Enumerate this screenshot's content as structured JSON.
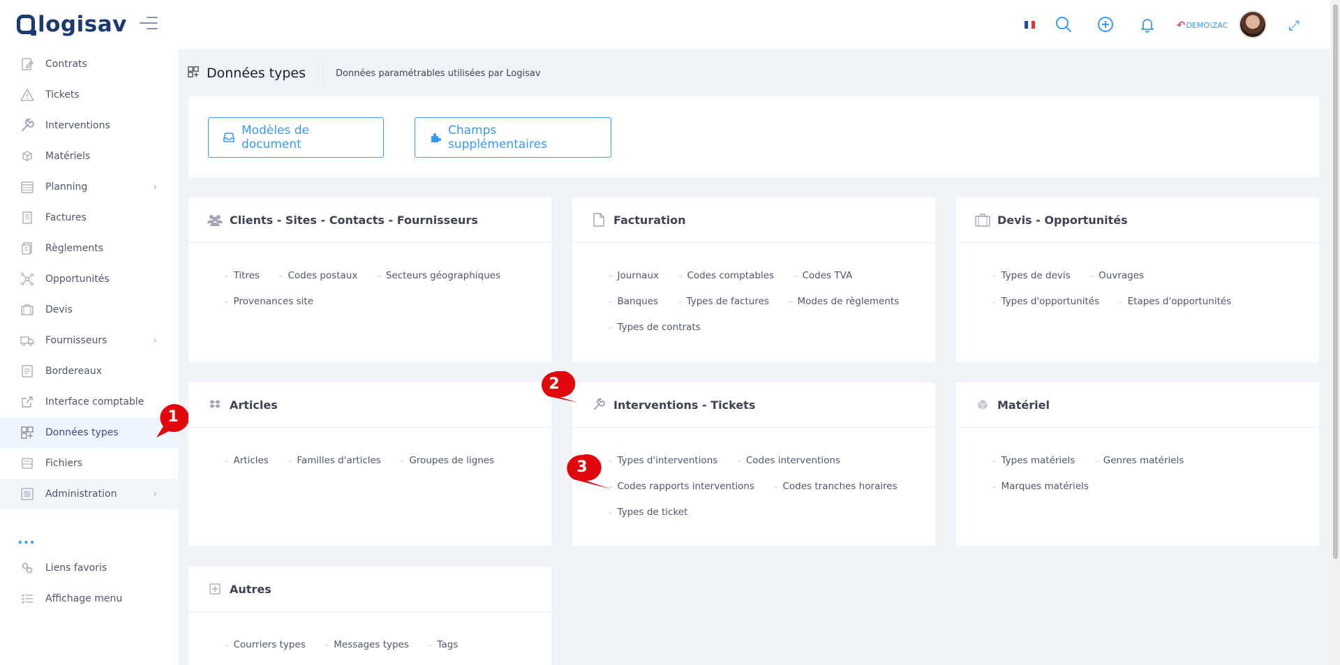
{
  "brand": {
    "name": "logisav"
  },
  "header": {
    "user": "DEMO\\ZAC",
    "icons": [
      "flag-fr-icon",
      "search-icon",
      "plus-circle-icon",
      "bell-icon",
      "undo-icon",
      "avatar",
      "expand-icon"
    ],
    "colors": {
      "accent": "#3699ff",
      "danger": "#f1416c",
      "brand": "#1c3a6e"
    }
  },
  "sidebar": {
    "items": [
      {
        "label": "Contrats",
        "icon": "contract-icon"
      },
      {
        "label": "Tickets",
        "icon": "warning-triangle-icon"
      },
      {
        "label": "Interventions",
        "icon": "wrench-icon"
      },
      {
        "label": "Matériels",
        "icon": "cube-icon"
      },
      {
        "label": "Planning",
        "icon": "calendar-icon",
        "has_children": true
      },
      {
        "label": "Factures",
        "icon": "invoice-icon"
      },
      {
        "label": "Règlements",
        "icon": "payments-icon"
      },
      {
        "label": "Opportunités",
        "icon": "network-icon"
      },
      {
        "label": "Devis",
        "icon": "briefcase-icon"
      },
      {
        "label": "Fournisseurs",
        "icon": "truck-icon",
        "has_children": true
      },
      {
        "label": "Bordereaux",
        "icon": "list-icon"
      },
      {
        "label": "Interface comptable",
        "icon": "external-link-icon"
      },
      {
        "label": "Données types",
        "icon": "grid-plus-icon",
        "active": true
      },
      {
        "label": "Fichiers",
        "icon": "folder-icon"
      },
      {
        "label": "Administration",
        "icon": "sliders-icon",
        "has_children": true
      }
    ],
    "more": "...",
    "bottom_items": [
      {
        "label": "Liens favoris",
        "icon": "link-icon"
      },
      {
        "label": "Affichage menu",
        "icon": "checklist-icon"
      }
    ]
  },
  "subheader": {
    "title": "Données types",
    "description": "Données paramétrables utilisées par Logisav"
  },
  "top_buttons": {
    "document_models": "Modèles de document",
    "extra_fields": "Champs supplémentaires"
  },
  "cards": {
    "clients": {
      "title": "Clients - Sites - Contacts - Fournisseurs",
      "rows": [
        [
          "Titres",
          "Codes postaux",
          "Secteurs géographiques"
        ],
        [
          "Provenances site"
        ]
      ]
    },
    "facturation": {
      "title": "Facturation",
      "rows": [
        [
          "Journaux",
          "Codes comptables",
          "Codes TVA"
        ],
        [
          "Banques",
          "Types de factures",
          "Modes de règlements"
        ],
        [
          "Types de contrats"
        ]
      ]
    },
    "devis": {
      "title": "Devis - Opportunités",
      "rows": [
        [
          "Types de devis",
          "Ouvrages"
        ],
        [
          "Types d'opportunités",
          "Etapes d'opportunités"
        ]
      ]
    },
    "articles": {
      "title": "Articles",
      "rows": [
        [
          "Articles",
          "Familles d'articles",
          "Groupes de lignes"
        ]
      ]
    },
    "interventions": {
      "title": "Interventions - Tickets",
      "rows": [
        [
          "Types d'interventions",
          "Codes interventions"
        ],
        [
          "Codes rapports interventions",
          "Codes tranches horaires"
        ],
        [
          "Types de ticket"
        ]
      ]
    },
    "materiel": {
      "title": "Matériel",
      "rows": [
        [
          "Types matériels",
          "Genres matériels"
        ],
        [
          "Marques matériels"
        ]
      ]
    },
    "autres": {
      "title": "Autres",
      "rows": [
        [
          "Courriers types",
          "Messages types",
          "Tags"
        ]
      ]
    }
  },
  "callouts": [
    "1",
    "2",
    "3"
  ]
}
